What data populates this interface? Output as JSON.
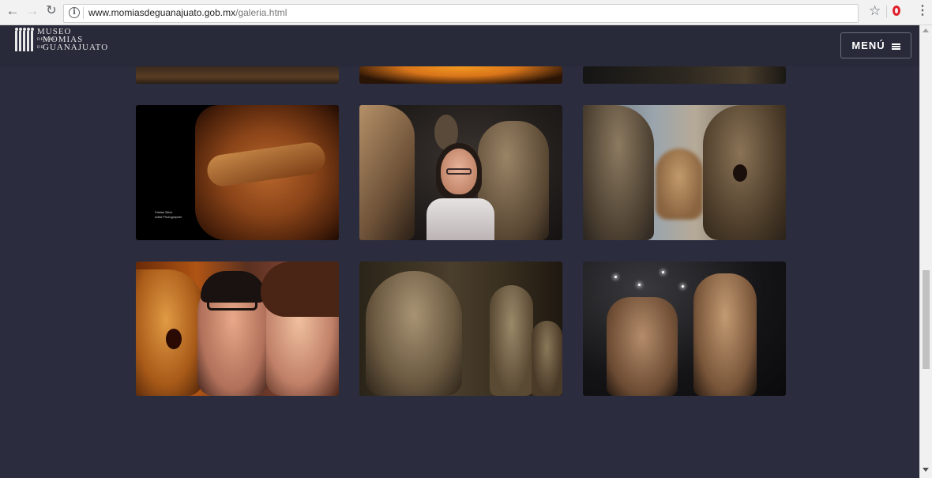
{
  "browser": {
    "url_host": "www.momiasdeguanajuato.gob.mx",
    "url_path": "/galeria.html",
    "icons": [
      "back-arrow-icon",
      "forward-arrow-icon",
      "reload-icon",
      "info-icon",
      "star-icon",
      "opera-icon",
      "kebab-menu-icon"
    ]
  },
  "header": {
    "logo_line1": "MUSEO",
    "logo_small1": "DE LAS",
    "logo_line2": "MOMIAS",
    "logo_small2": "DE",
    "logo_line3": "GUANAJUATO",
    "menu_label": "MENÚ"
  },
  "gallery": {
    "photo_credit_name": "Fabian Bück",
    "photo_credit_role": "Artist Photographer"
  },
  "colors": {
    "page_background": "#2b2c3d",
    "accent_opera": "#e0202a"
  }
}
